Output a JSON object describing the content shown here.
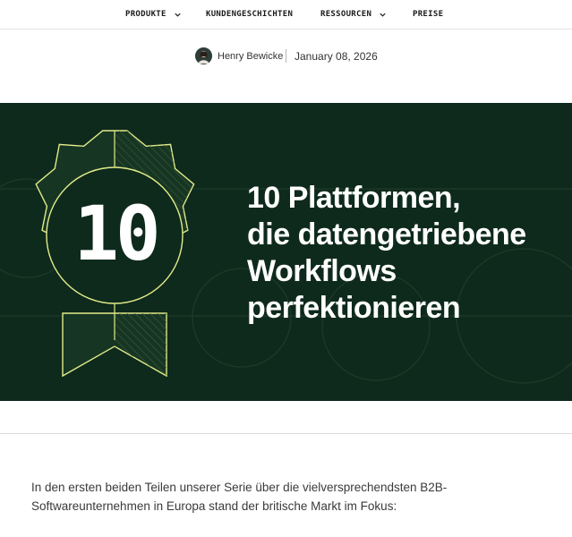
{
  "nav": {
    "items": [
      {
        "label": "PRODUKTE",
        "has_dropdown": true
      },
      {
        "label": "KUNDENGESCHICHTEN",
        "has_dropdown": false
      },
      {
        "label": "RESSOURCEN",
        "has_dropdown": true
      },
      {
        "label": "PREISE",
        "has_dropdown": false
      }
    ]
  },
  "byline": {
    "author": "Henry Bewicke",
    "date": "January 08, 2026",
    "avatar_icon": "author-avatar"
  },
  "hero": {
    "badge_number": "10",
    "title_lines": [
      "10 Plattformen,",
      "die datengetriebene",
      "Workflows",
      "perfektionieren"
    ],
    "colors": {
      "background": "#0e2a1c",
      "badge_outline": "#e3eb8a",
      "text": "#ffffff"
    }
  },
  "article": {
    "intro": "In den ersten beiden Teilen unserer Serie über die vielversprechendsten B2B-Softwareunternehmen in Europa stand der britische Markt im Fokus:"
  }
}
